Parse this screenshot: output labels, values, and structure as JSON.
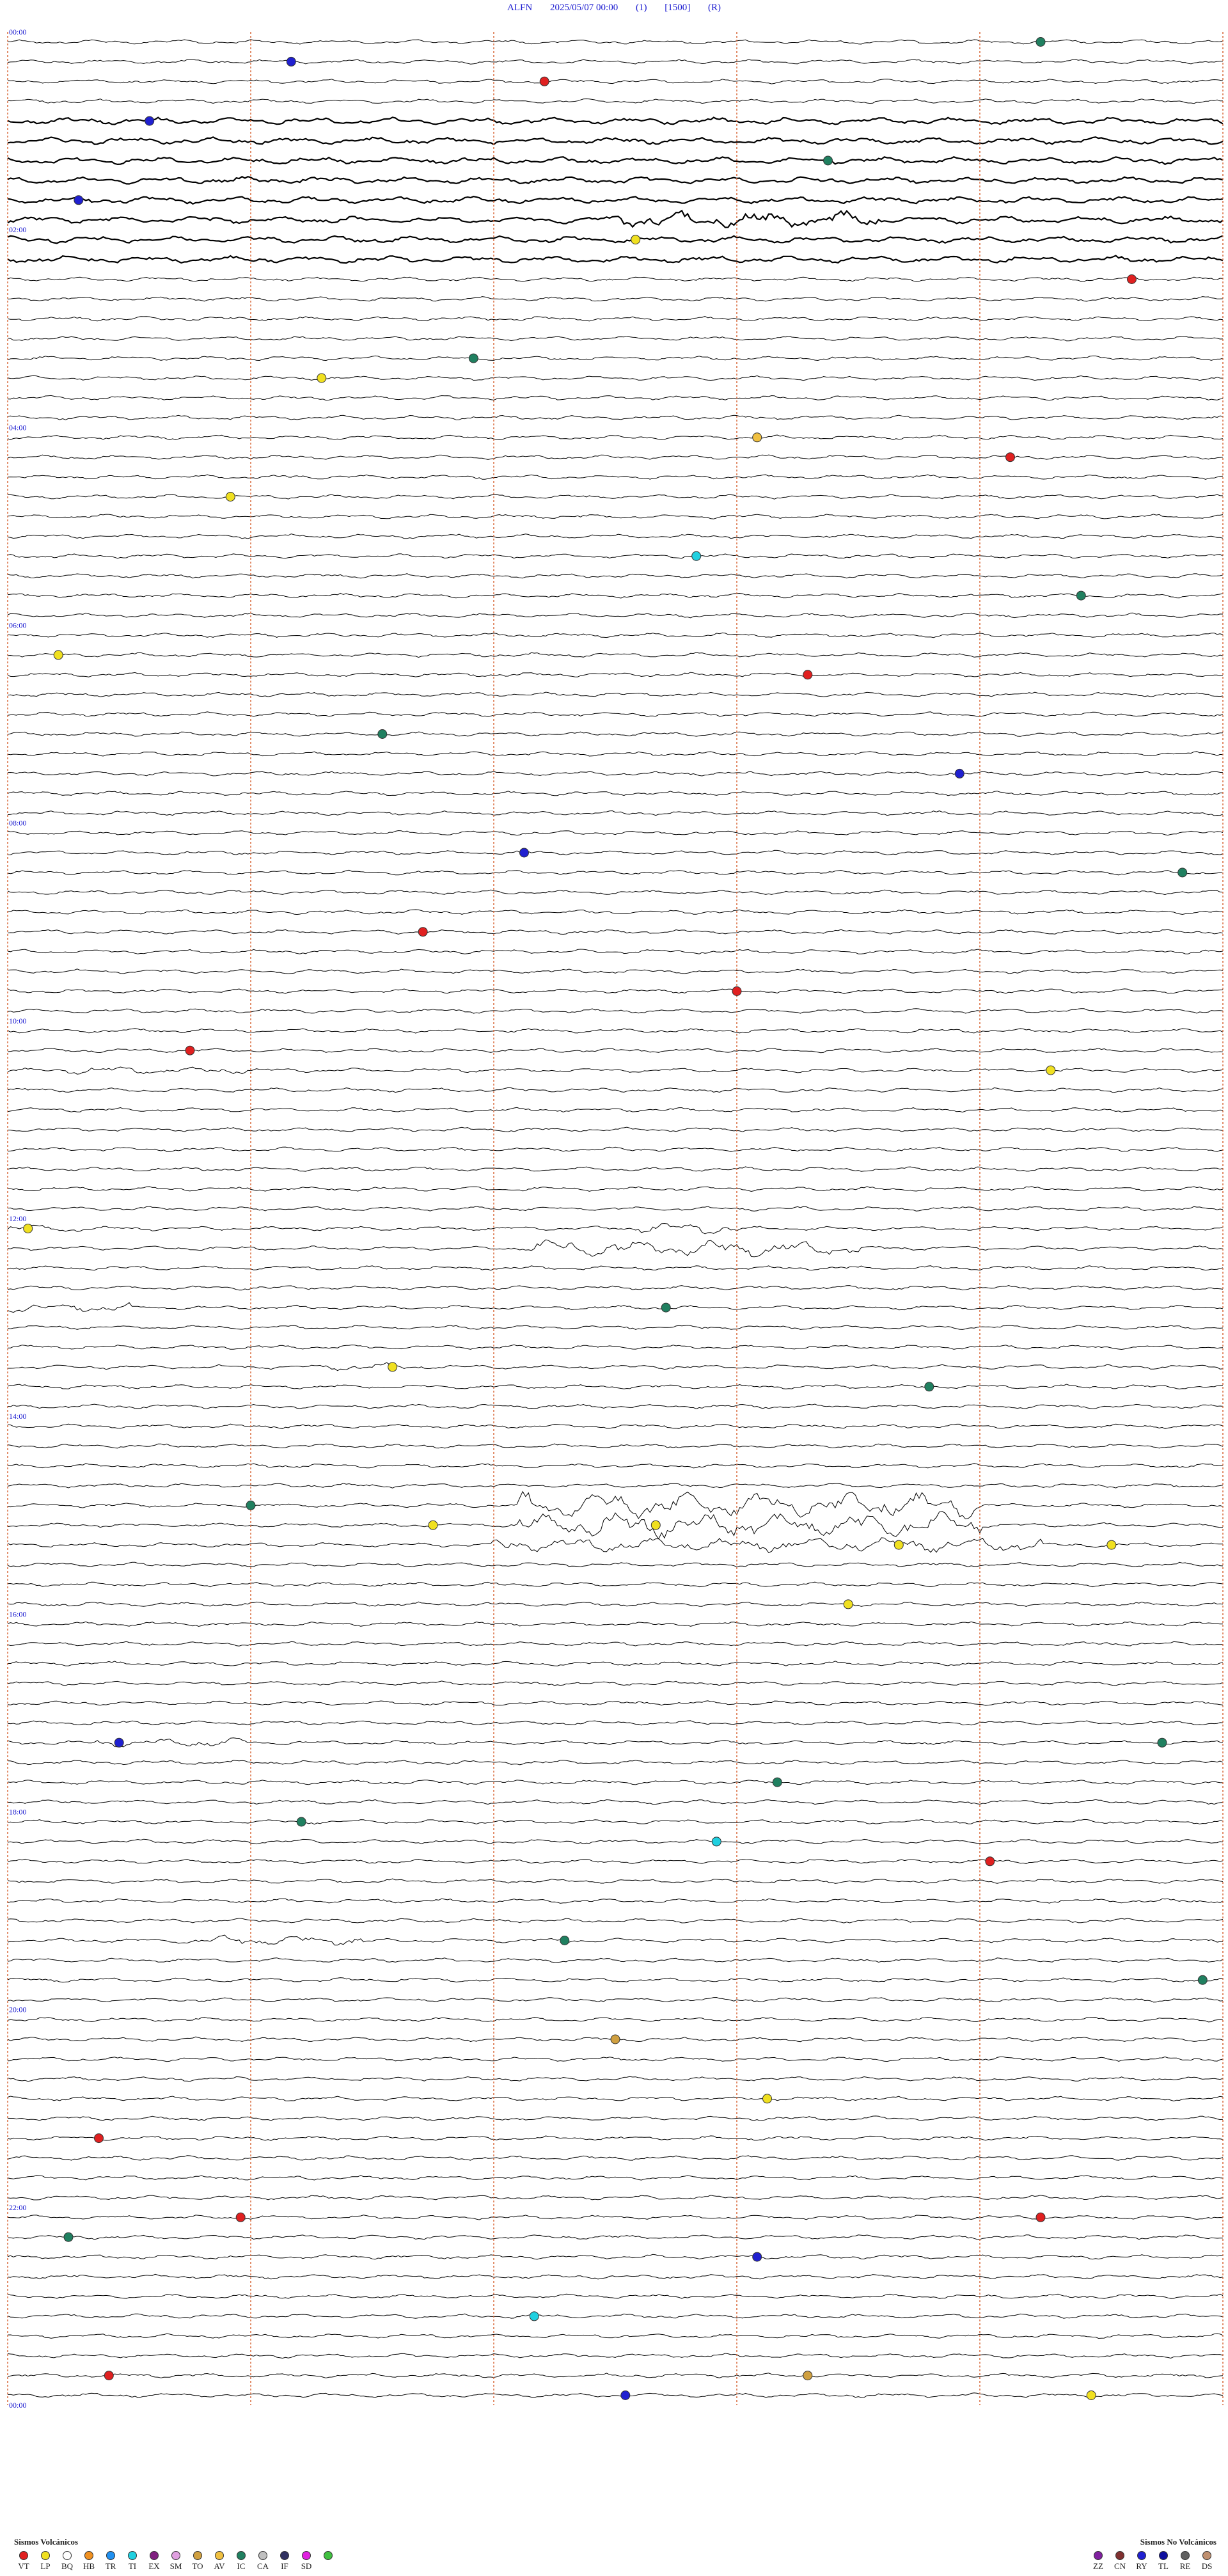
{
  "header": {
    "station": "ALFN",
    "datetime": "2025/05/07 00:00",
    "channel": "(1)",
    "scale": "[1500]",
    "mode": "(R)"
  },
  "chart_data": {
    "type": "helicorder",
    "station": "ALFN",
    "start": "2025/05/07 00:00",
    "end": "2025/05/08 00:00",
    "lines_per_hour": 5,
    "minutes_per_line": 12,
    "hour_labels": [
      "00:00",
      "",
      "02:00",
      "",
      "04:00",
      "",
      "06:00",
      "",
      "08:00",
      "",
      "10:00",
      "",
      "12:00",
      "",
      "14:00",
      "",
      "16:00",
      "",
      "18:00",
      "",
      "20:00",
      "",
      "22:00",
      "",
      "00:00"
    ],
    "colors": {
      "trace": "#000000",
      "minute_marker": "#d9693a",
      "label": "#1a1ad0"
    },
    "events": [
      {
        "hour": 0.1,
        "minute": 10.2,
        "code": "IC"
      },
      {
        "hour": 0.2,
        "minute": 2.8,
        "code": "RY"
      },
      {
        "hour": 0.5,
        "minute": 5.3,
        "code": "VT"
      },
      {
        "hour": 0.9,
        "minute": 1.4,
        "code": "RY"
      },
      {
        "hour": 1.3,
        "minute": 8.1,
        "code": "IC"
      },
      {
        "hour": 1.6,
        "minute": 0.7,
        "code": "RY"
      },
      {
        "hour": 2.1,
        "minute": 6.2,
        "code": "LP"
      },
      {
        "hour": 2.4,
        "minute": 11.1,
        "code": "VT"
      },
      {
        "hour": 3.2,
        "minute": 4.6,
        "code": "IC"
      },
      {
        "hour": 3.5,
        "minute": 3.1,
        "code": "LP"
      },
      {
        "hour": 4.1,
        "minute": 7.4,
        "code": "AV"
      },
      {
        "hour": 4.3,
        "minute": 9.9,
        "code": "VT"
      },
      {
        "hour": 4.7,
        "minute": 2.2,
        "code": "LP"
      },
      {
        "hour": 5.2,
        "minute": 6.8,
        "code": "TI"
      },
      {
        "hour": 5.7,
        "minute": 10.6,
        "code": "IC"
      },
      {
        "hour": 6.3,
        "minute": 0.5,
        "code": "LP"
      },
      {
        "hour": 6.5,
        "minute": 7.9,
        "code": "VT"
      },
      {
        "hour": 7.1,
        "minute": 3.7,
        "code": "IC"
      },
      {
        "hour": 7.4,
        "minute": 9.4,
        "code": "RY"
      },
      {
        "hour": 8.2,
        "minute": 5.1,
        "code": "RY"
      },
      {
        "hour": 8.4,
        "minute": 11.6,
        "code": "IC"
      },
      {
        "hour": 9.1,
        "minute": 4.1,
        "code": "VT"
      },
      {
        "hour": 9.6,
        "minute": 7.2,
        "code": "VT"
      },
      {
        "hour": 10.3,
        "minute": 1.8,
        "code": "VT"
      },
      {
        "hour": 10.5,
        "minute": 10.3,
        "code": "LP"
      },
      {
        "hour": 12.0,
        "minute": 0.2,
        "code": "LP"
      },
      {
        "hour": 12.8,
        "minute": 6.5,
        "code": "IC"
      },
      {
        "hour": 13.4,
        "minute": 3.8,
        "code": "LP"
      },
      {
        "hour": 13.7,
        "minute": 9.1,
        "code": "IC"
      },
      {
        "hour": 14.8,
        "minute": 2.4,
        "code": "IC"
      },
      {
        "hour": 15.0,
        "minute": 4.2,
        "code": "LP"
      },
      {
        "hour": 15.1,
        "minute": 6.4,
        "code": "LP"
      },
      {
        "hour": 15.2,
        "minute": 8.8,
        "code": "LP"
      },
      {
        "hour": 15.3,
        "minute": 10.9,
        "code": "LP"
      },
      {
        "hour": 15.9,
        "minute": 8.3,
        "code": "LP"
      },
      {
        "hour": 17.2,
        "minute": 1.1,
        "code": "RY"
      },
      {
        "hour": 17.3,
        "minute": 11.4,
        "code": "IC"
      },
      {
        "hour": 17.7,
        "minute": 7.6,
        "code": "IC"
      },
      {
        "hour": 18.1,
        "minute": 2.9,
        "code": "IC"
      },
      {
        "hour": 18.3,
        "minute": 7.0,
        "code": "TI"
      },
      {
        "hour": 18.5,
        "minute": 9.7,
        "code": "VT"
      },
      {
        "hour": 19.3,
        "minute": 5.5,
        "code": "IC"
      },
      {
        "hour": 19.6,
        "minute": 11.8,
        "code": "IC"
      },
      {
        "hour": 20.3,
        "minute": 6.0,
        "code": "TO"
      },
      {
        "hour": 20.8,
        "minute": 7.5,
        "code": "LP"
      },
      {
        "hour": 21.3,
        "minute": 0.9,
        "code": "VT"
      },
      {
        "hour": 22.0,
        "minute": 2.3,
        "code": "VT"
      },
      {
        "hour": 22.0,
        "minute": 10.2,
        "code": "VT"
      },
      {
        "hour": 22.2,
        "minute": 0.6,
        "code": "IC"
      },
      {
        "hour": 22.4,
        "minute": 7.4,
        "code": "RY"
      },
      {
        "hour": 23.1,
        "minute": 5.2,
        "code": "TI"
      },
      {
        "hour": 23.6,
        "minute": 1.0,
        "code": "VT"
      },
      {
        "hour": 23.6,
        "minute": 7.9,
        "code": "TO"
      },
      {
        "hour": 23.9,
        "minute": 6.1,
        "code": "RY"
      },
      {
        "hour": 23.9,
        "minute": 10.7,
        "code": "LP"
      }
    ]
  },
  "legend": {
    "volcanic": {
      "title": "Sismos Volcánicos",
      "items": [
        {
          "code": "VT",
          "color": "#e02020"
        },
        {
          "code": "LP",
          "color": "#f0e020"
        },
        {
          "code": "BQ",
          "color": "#ffffff"
        },
        {
          "code": "HB",
          "color": "#f09020"
        },
        {
          "code": "TR",
          "color": "#2090f0"
        },
        {
          "code": "TI",
          "color": "#20d0e0"
        },
        {
          "code": "EX",
          "color": "#802080"
        },
        {
          "code": "SM",
          "color": "#e0a0e0"
        },
        {
          "code": "TO",
          "color": "#d0a040"
        },
        {
          "code": "AV",
          "color": "#f0c040"
        },
        {
          "code": "IC",
          "color": "#208060"
        },
        {
          "code": "CA",
          "color": "#c0c0c0"
        },
        {
          "code": "IF",
          "color": "#303060"
        },
        {
          "code": "SD",
          "color": "#e020e0"
        },
        {
          "code": "",
          "color": "#40c040"
        }
      ]
    },
    "nonvolcanic": {
      "title": "Sismos No Volcánicos",
      "items": [
        {
          "code": "ZZ",
          "color": "#8020a0"
        },
        {
          "code": "CN",
          "color": "#803030"
        },
        {
          "code": "RY",
          "color": "#2020d0"
        },
        {
          "code": "TL",
          "color": "#1010a0"
        },
        {
          "code": "RE",
          "color": "#606060"
        },
        {
          "code": "DS",
          "color": "#c09070"
        }
      ]
    }
  }
}
